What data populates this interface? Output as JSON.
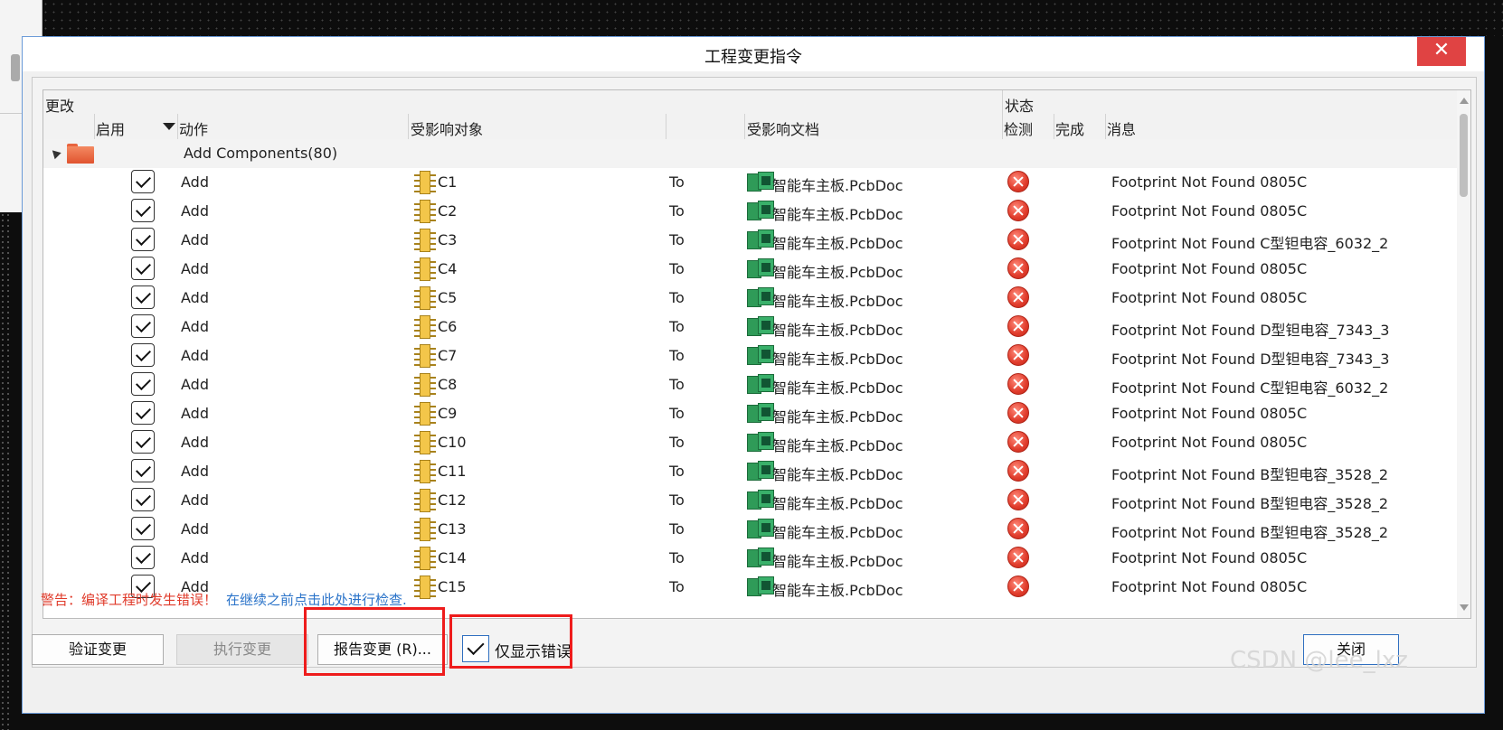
{
  "dialog": {
    "title": "工程变更指令",
    "close_glyph": "✕"
  },
  "header": {
    "group_changes": "更改",
    "group_status": "状态",
    "col_enable": "启用",
    "col_action": "动作",
    "col_object": "受影响对象",
    "col_doc": "受影响文档",
    "col_check": "检测",
    "col_done": "完成",
    "col_msg": "消息"
  },
  "group_row": {
    "label": "Add Components(80)",
    "icon": "folder-icon"
  },
  "rows": [
    {
      "action": "Add",
      "object": "C1",
      "to": "To",
      "doc": "智能车主板.PcbDoc",
      "message": "Footprint Not Found 0805C"
    },
    {
      "action": "Add",
      "object": "C2",
      "to": "To",
      "doc": "智能车主板.PcbDoc",
      "message": "Footprint Not Found 0805C"
    },
    {
      "action": "Add",
      "object": "C3",
      "to": "To",
      "doc": "智能车主板.PcbDoc",
      "message": "Footprint Not Found C型钽电容_6032_2"
    },
    {
      "action": "Add",
      "object": "C4",
      "to": "To",
      "doc": "智能车主板.PcbDoc",
      "message": "Footprint Not Found 0805C"
    },
    {
      "action": "Add",
      "object": "C5",
      "to": "To",
      "doc": "智能车主板.PcbDoc",
      "message": "Footprint Not Found 0805C"
    },
    {
      "action": "Add",
      "object": "C6",
      "to": "To",
      "doc": "智能车主板.PcbDoc",
      "message": "Footprint Not Found D型钽电容_7343_3"
    },
    {
      "action": "Add",
      "object": "C7",
      "to": "To",
      "doc": "智能车主板.PcbDoc",
      "message": "Footprint Not Found D型钽电容_7343_3"
    },
    {
      "action": "Add",
      "object": "C8",
      "to": "To",
      "doc": "智能车主板.PcbDoc",
      "message": "Footprint Not Found C型钽电容_6032_2"
    },
    {
      "action": "Add",
      "object": "C9",
      "to": "To",
      "doc": "智能车主板.PcbDoc",
      "message": "Footprint Not Found 0805C"
    },
    {
      "action": "Add",
      "object": "C10",
      "to": "To",
      "doc": "智能车主板.PcbDoc",
      "message": "Footprint Not Found 0805C"
    },
    {
      "action": "Add",
      "object": "C11",
      "to": "To",
      "doc": "智能车主板.PcbDoc",
      "message": "Footprint Not Found B型钽电容_3528_2"
    },
    {
      "action": "Add",
      "object": "C12",
      "to": "To",
      "doc": "智能车主板.PcbDoc",
      "message": "Footprint Not Found B型钽电容_3528_2"
    },
    {
      "action": "Add",
      "object": "C13",
      "to": "To",
      "doc": "智能车主板.PcbDoc",
      "message": "Footprint Not Found B型钽电容_3528_2"
    },
    {
      "action": "Add",
      "object": "C14",
      "to": "To",
      "doc": "智能车主板.PcbDoc",
      "message": "Footprint Not Found 0805C"
    },
    {
      "action": "Add",
      "object": "C15",
      "to": "To",
      "doc": "智能车主板.PcbDoc",
      "message": "Footprint Not Found 0805C"
    }
  ],
  "warning": {
    "text": "警告：编译工程时发生错误！",
    "link": "在继续之前点击此处进行检查."
  },
  "buttons": {
    "validate": "验证变更",
    "execute": "执行变更",
    "report": "报告变更 (R)...",
    "close": "关闭"
  },
  "only_errors": {
    "label": "仅显示错误",
    "checked": true
  },
  "watermark": "CSDN @lee_lxz",
  "colors": {
    "error_red": "#e03b2b",
    "link_blue": "#2a73c9",
    "highlight_red": "#ee1c1c",
    "close_red": "#e04343"
  }
}
